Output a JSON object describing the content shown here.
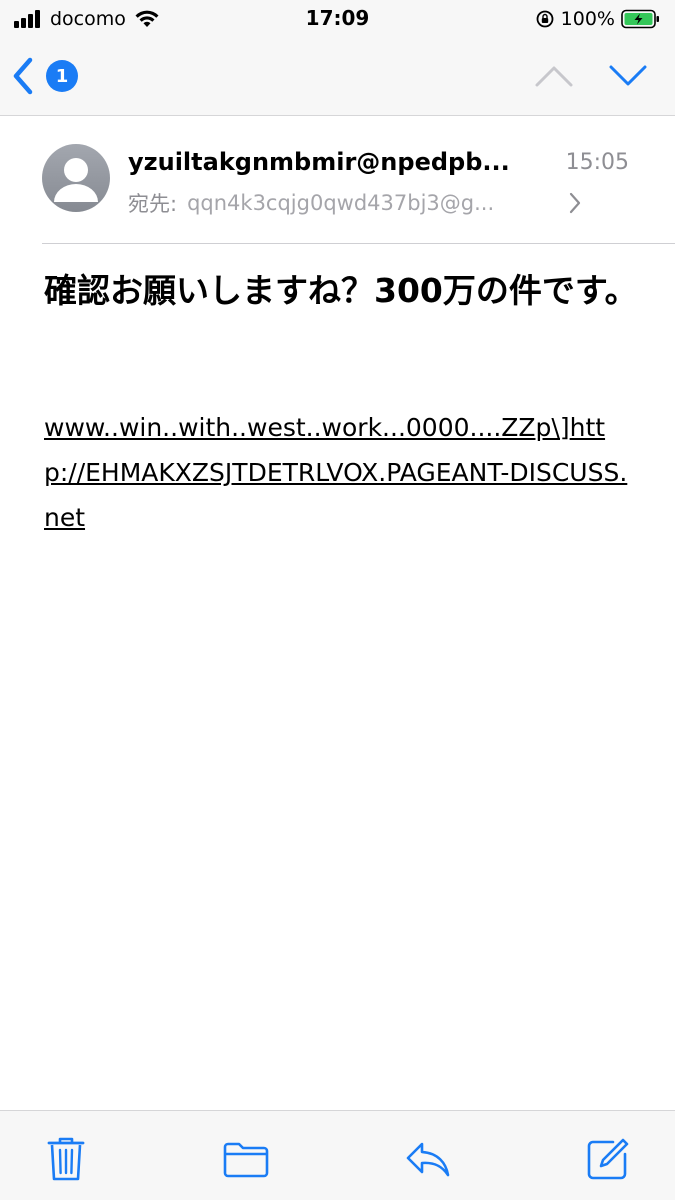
{
  "status_bar": {
    "carrier": "docomo",
    "time": "17:09",
    "battery_percent": "100%",
    "signal_bars": 4
  },
  "nav": {
    "unread_count": "1",
    "accent_color": "#1a7cf5"
  },
  "message": {
    "from": "yzuiltakgnmbmir@npedpb...",
    "time": "15:05",
    "to_label": "宛先:",
    "to_value": "qqn4k3cqjg0qwd437bj3@g...",
    "subject": "確認お願いしますね？300万の件です。",
    "body_prefix": "www..win..with..west..work...0000....ZZp\\]",
    "body_link": "http://EHMAKXZSJTDETRLVOX.PAGEANT-DISCUSS.net"
  },
  "toolbar": {
    "icons": [
      "trash-icon",
      "folder-icon",
      "reply-icon",
      "compose-icon"
    ]
  }
}
